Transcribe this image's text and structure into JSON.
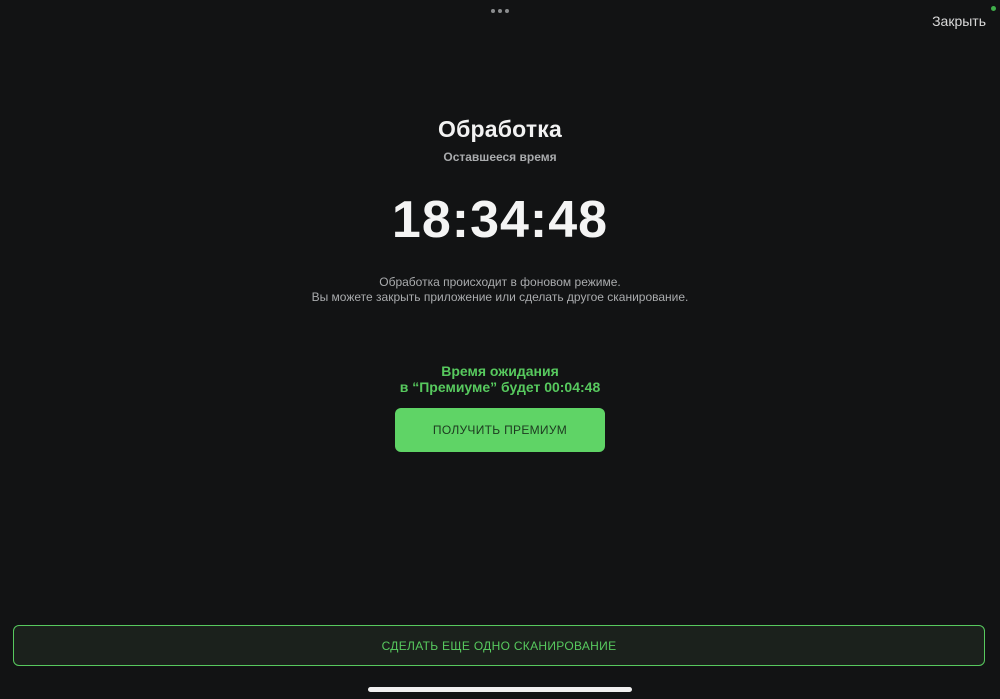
{
  "header": {
    "close_label": "Закрыть"
  },
  "processing": {
    "title": "Обработка",
    "subtitle": "Оставшееся время",
    "timer": "18:34:48",
    "info_line1": "Обработка происходит в фоновом режиме.",
    "info_line2": "Вы можете закрыть приложение или сделать другое сканирование."
  },
  "premium": {
    "wait_line1": "Время ожидания",
    "wait_line2": "в “Премиуме” будет 00:04:48",
    "button_label": "ПОЛУЧИТЬ ПРЕМИУМ"
  },
  "footer": {
    "rescan_label": "СДЕЛАТЬ ЕЩЕ ОДНО СКАНИРОВАНИЕ"
  },
  "icons": {
    "more": "more-dots-icon",
    "status": "status-dot-icon"
  },
  "colors": {
    "background": "#121314",
    "accent": "#5fd466",
    "accent_text": "#57c95e"
  }
}
